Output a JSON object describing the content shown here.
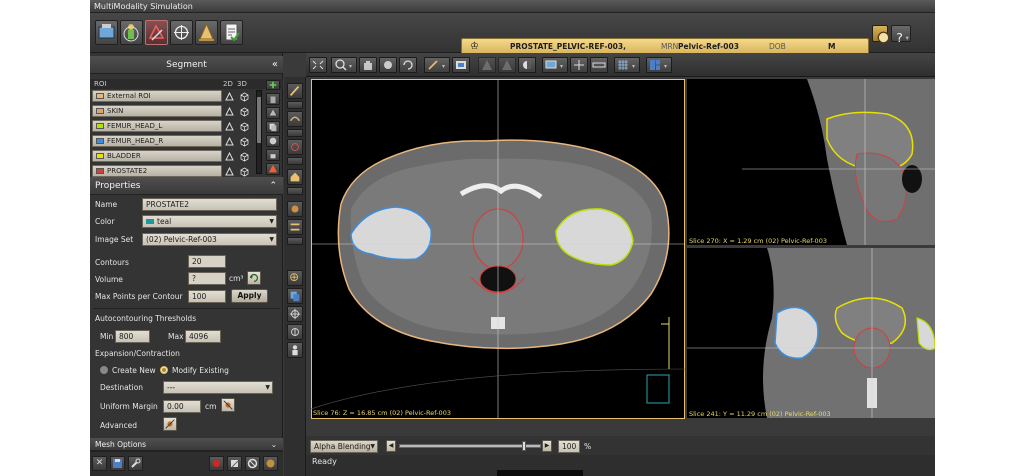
{
  "app": {
    "title": "MultiModality Simulation"
  },
  "patient": {
    "name": "PROSTATE_PELVIC-REF-003,",
    "mrn_label": "MRN",
    "mrn": "Pelvic-Ref-003",
    "dob_label": "DOB",
    "sex": "M"
  },
  "segment": {
    "title": "Segment",
    "roi_col": "ROI",
    "col_2d": "2D",
    "col_3d": "3D",
    "rois": [
      {
        "name": "External ROI",
        "color": "#e8b57c"
      },
      {
        "name": "SKIN",
        "color": "#e0a070"
      },
      {
        "name": "FEMUR_HEAD_L",
        "color": "#b8e000"
      },
      {
        "name": "FEMUR_HEAD_R",
        "color": "#3a8ee0"
      },
      {
        "name": "BLADDER",
        "color": "#e8e000"
      },
      {
        "name": "PROSTATE2",
        "color": "#d04040"
      }
    ]
  },
  "properties": {
    "title": "Properties",
    "name_label": "Name",
    "name_value": "PROSTATE2",
    "color_label": "Color",
    "color_value": "teal",
    "color_hex": "#1c9a9a",
    "imageset_label": "Image Set",
    "imageset_value": "(02) Pelvic-Ref-003",
    "contours_label": "Contours",
    "contours_value": "20",
    "volume_label": "Volume",
    "volume_value": "?",
    "volume_unit": "cm³",
    "maxpoints_label": "Max Points per Contour",
    "maxpoints_value": "100",
    "apply_label": "Apply",
    "autocontour_label": "Autocontouring Thresholds",
    "min_label": "Min",
    "min_value": "800",
    "max_label": "Max",
    "max_value": "4096",
    "expansion_label": "Expansion/Contraction",
    "create_new_label": "Create New",
    "modify_existing_label": "Modify Existing",
    "destination_label": "Destination",
    "destination_value": "---",
    "uniform_margin_label": "Uniform Margin",
    "uniform_margin_value": "0.00",
    "uniform_margin_unit": "cm",
    "advanced_label": "Advanced",
    "mesh_options_label": "Mesh Options"
  },
  "viewports": {
    "axial_label": "Slice 76: Z = 16.85 cm (02) Pelvic-Ref-003",
    "sagittal_label": "Slice 270: X = 1.29 cm (02) Pelvic-Ref-003",
    "coronal_label": "Slice 241: Y = 11.29 cm (02) Pelvic-Ref-003"
  },
  "blending": {
    "mode_value": "Alpha Blending",
    "percent_value": "100",
    "percent_unit": "%",
    "slider_fraction": 0.9
  },
  "status": {
    "text": "Ready"
  }
}
